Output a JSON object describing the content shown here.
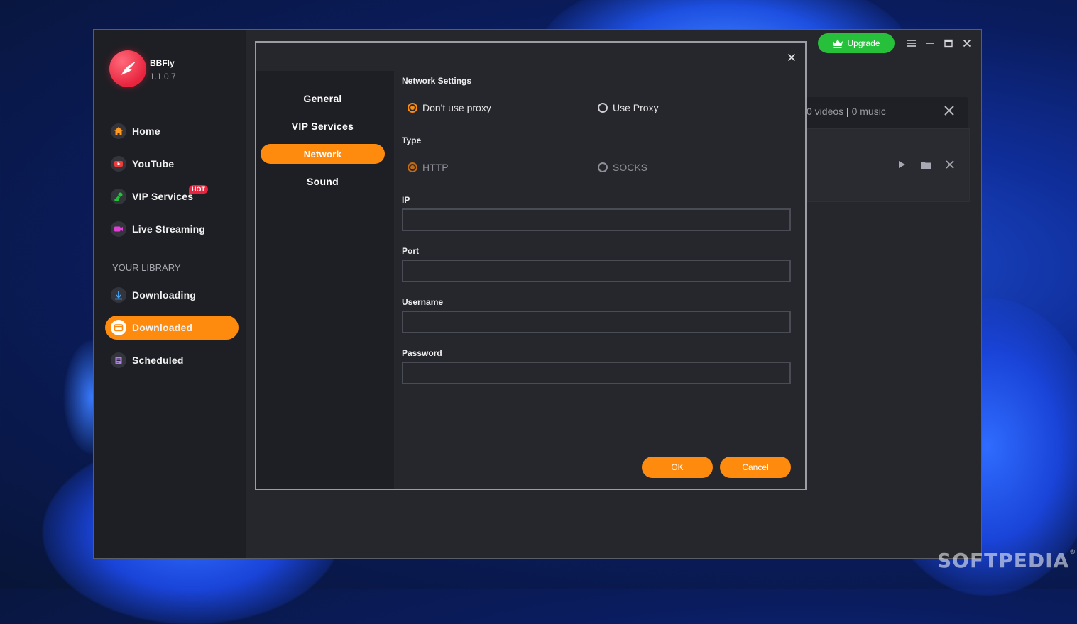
{
  "app": {
    "name": "BBFly",
    "version": "1.1.0.7"
  },
  "topbar": {
    "upgrade_label": "Upgrade"
  },
  "sidebar": {
    "items": [
      {
        "label": "Home",
        "icon": "home-icon"
      },
      {
        "label": "YouTube",
        "icon": "youtube-icon"
      },
      {
        "label": "VIP Services",
        "icon": "key-icon",
        "badge": "HOT"
      },
      {
        "label": "Live Streaming",
        "icon": "video-camera-icon"
      }
    ],
    "library_title": "YOUR LIBRARY",
    "library_items": [
      {
        "label": "Downloading",
        "icon": "download-icon"
      },
      {
        "label": "Downloaded",
        "icon": "folder-icon",
        "active": true
      },
      {
        "label": "Scheduled",
        "icon": "calendar-icon"
      }
    ]
  },
  "background_panel": {
    "videos": "0 videos",
    "separator": "|",
    "music": "0 music"
  },
  "dialog": {
    "tabs": [
      {
        "label": "General"
      },
      {
        "label": "VIP Services"
      },
      {
        "label": "Network",
        "active": true
      },
      {
        "label": "Sound"
      }
    ],
    "network_settings_title": "Network Settings",
    "proxy_options": [
      {
        "label": "Don't use proxy",
        "checked": true
      },
      {
        "label": "Use Proxy",
        "checked": false
      }
    ],
    "type_title": "Type",
    "type_options": [
      {
        "label": "HTTP",
        "checked": true
      },
      {
        "label": "SOCKS",
        "checked": false
      }
    ],
    "fields": {
      "ip": {
        "label": "IP",
        "value": ""
      },
      "port": {
        "label": "Port",
        "value": ""
      },
      "username": {
        "label": "Username",
        "value": ""
      },
      "password": {
        "label": "Password",
        "value": ""
      }
    },
    "ok_label": "OK",
    "cancel_label": "Cancel"
  },
  "watermark": {
    "text": "SOFTPEDIA",
    "mark": "®"
  },
  "colors": {
    "accent": "#ff8b0e",
    "upgrade": "#26c03a",
    "hot": "#e8243e",
    "background": "#26272d",
    "sidebar": "#1e1f24"
  }
}
